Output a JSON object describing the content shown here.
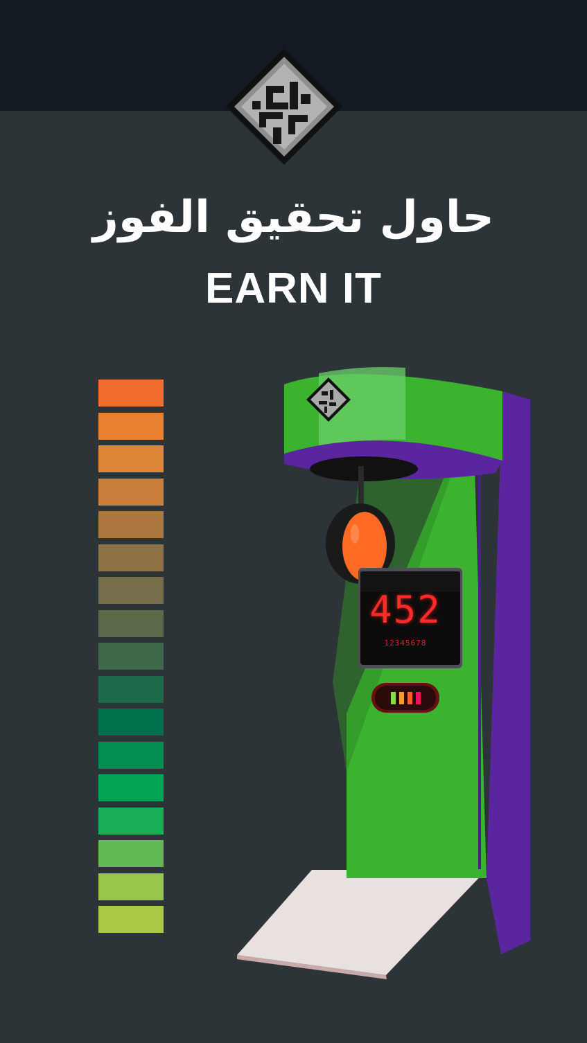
{
  "header": {
    "logo_icon": "nt-emblem-icon"
  },
  "title": {
    "arabic": "حاول تحقيق الفوز",
    "english": "EARN IT"
  },
  "strength_meter": {
    "segment_count": 17,
    "colors": [
      "#f16c2f",
      "#ea812f",
      "#df8738",
      "#c97f3b",
      "#ac7840",
      "#8f7244",
      "#766d4a",
      "#5d6a4a",
      "#3f6749",
      "#1d6a4a",
      "#00704c",
      "#018e50",
      "#03a454",
      "#17ae55",
      "#63b955",
      "#98c54c",
      "#a9c846"
    ]
  },
  "machine": {
    "display_value": "452",
    "display_digits": "12345678",
    "indicator_colors": [
      "#8bd94a",
      "#f39c2f",
      "#ff5c2f",
      "#e8175d"
    ],
    "body_color": "#3cb32e",
    "side_color": "#5b25a0",
    "bag_color": "#ff6a25",
    "logo_icon": "nt-emblem-icon"
  }
}
